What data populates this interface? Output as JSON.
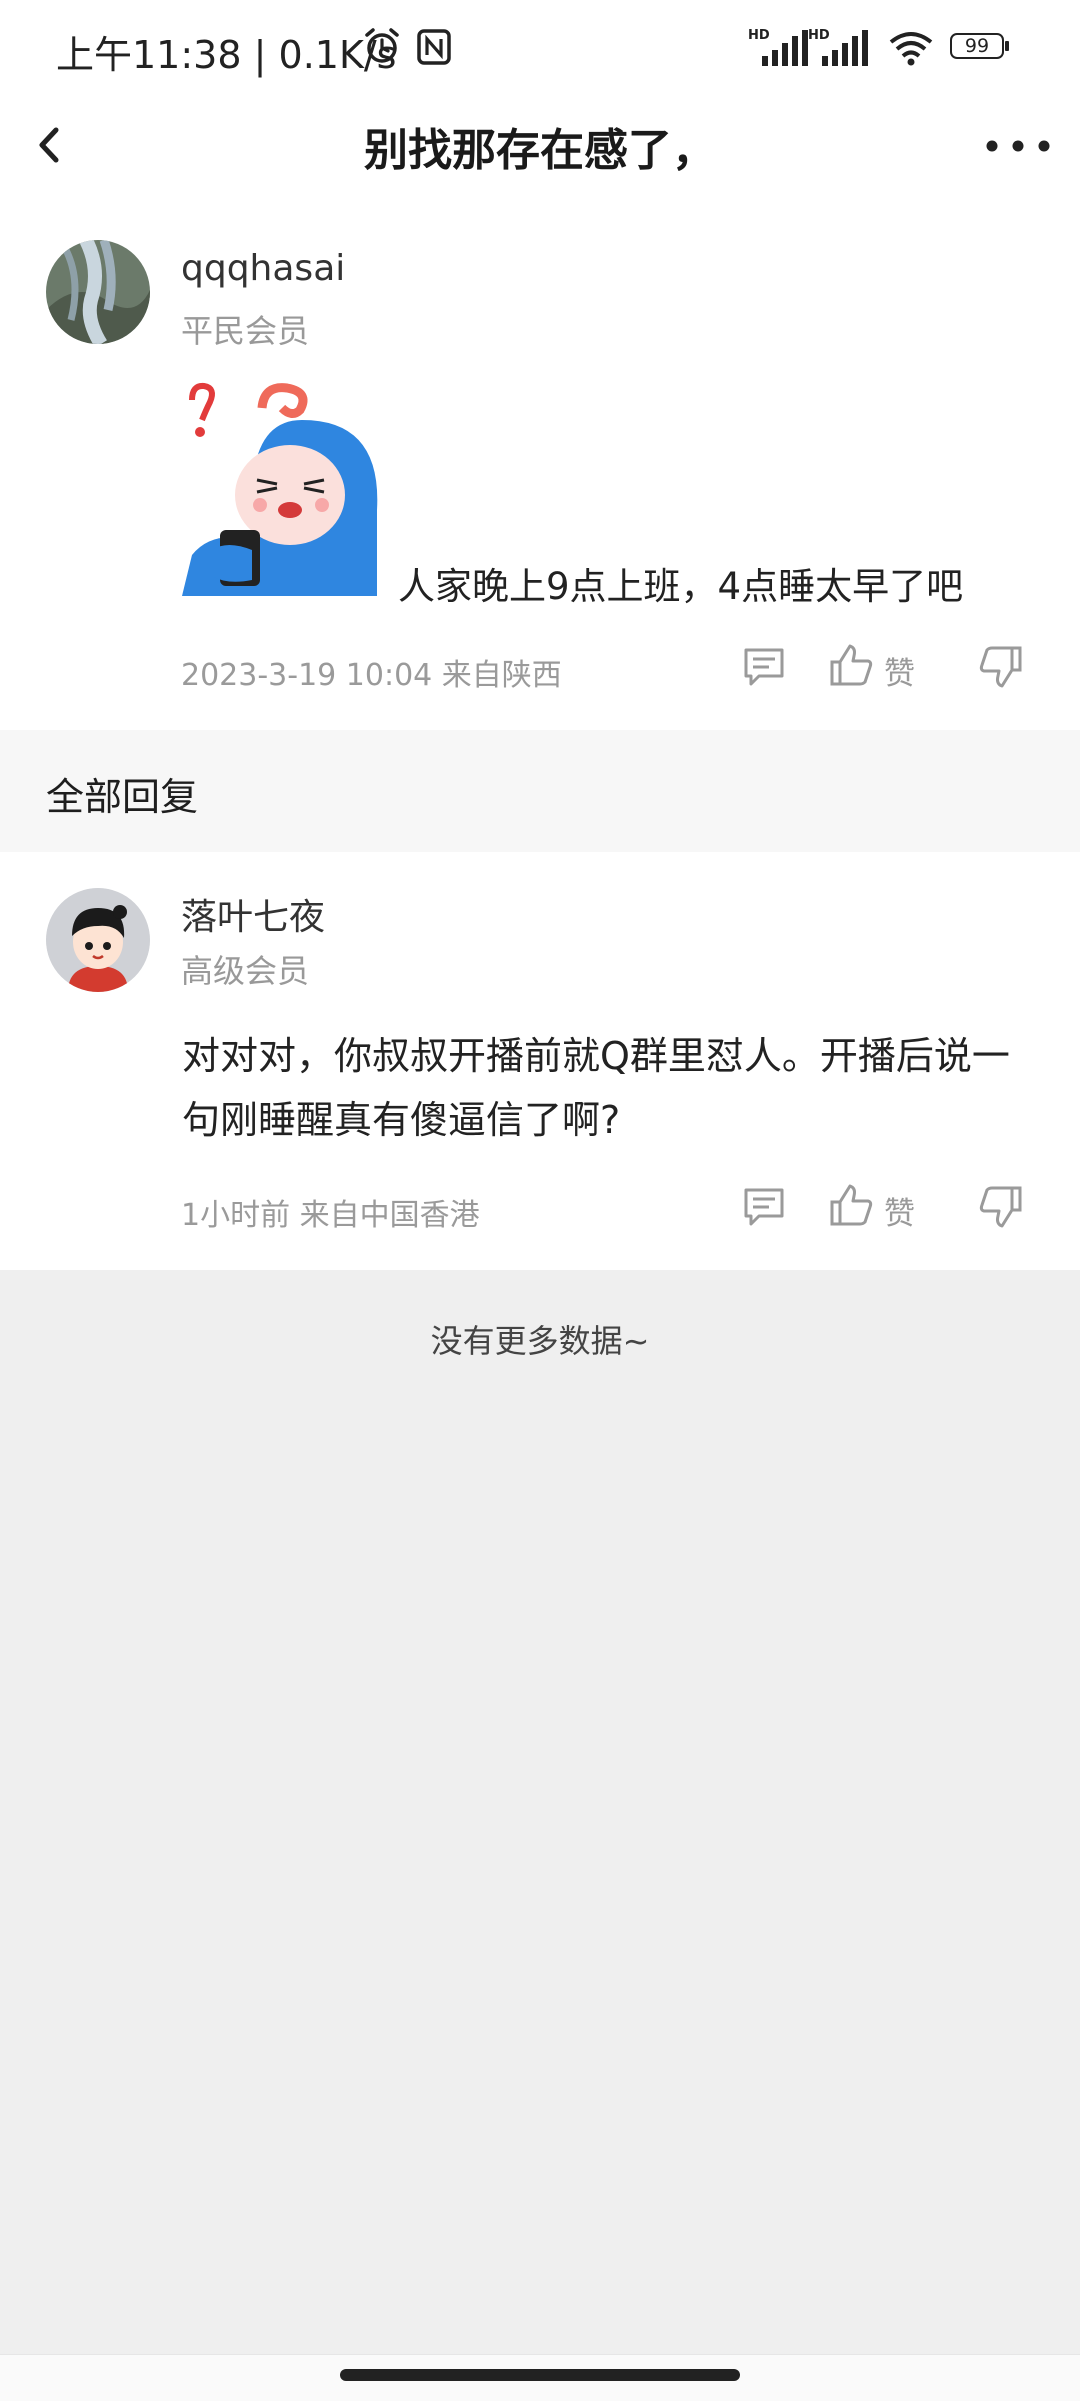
{
  "status_bar": {
    "time": "上午11:38",
    "separator": "|",
    "speed": "0.1K/s",
    "hd1": "HD",
    "hd2": "HD",
    "battery": "99"
  },
  "header": {
    "title": "别找那存在感了，"
  },
  "post": {
    "username": "qqqhasai",
    "level": "平民会员",
    "text": "人家晚上9点上班，4点睡太早了吧",
    "time": "2023-3-19 10:04",
    "location": "来自陕西",
    "like_label": "赞"
  },
  "section": {
    "all_replies": "全部回复"
  },
  "reply": {
    "username": "落叶七夜",
    "level": "高级会员",
    "text": "对对对，你叔叔开播前就Q群里怼人。开播后说一句刚睡醒真有傻逼信了啊?",
    "time": "1小时前",
    "location": "来自中国香港",
    "like_label": "赞"
  },
  "footer": {
    "no_more": "没有更多数据~"
  },
  "colors": {
    "background": "#efefef",
    "card": "#ffffff",
    "muted_text": "#9a9a9a",
    "emoji_blue": "#2f86e0"
  }
}
